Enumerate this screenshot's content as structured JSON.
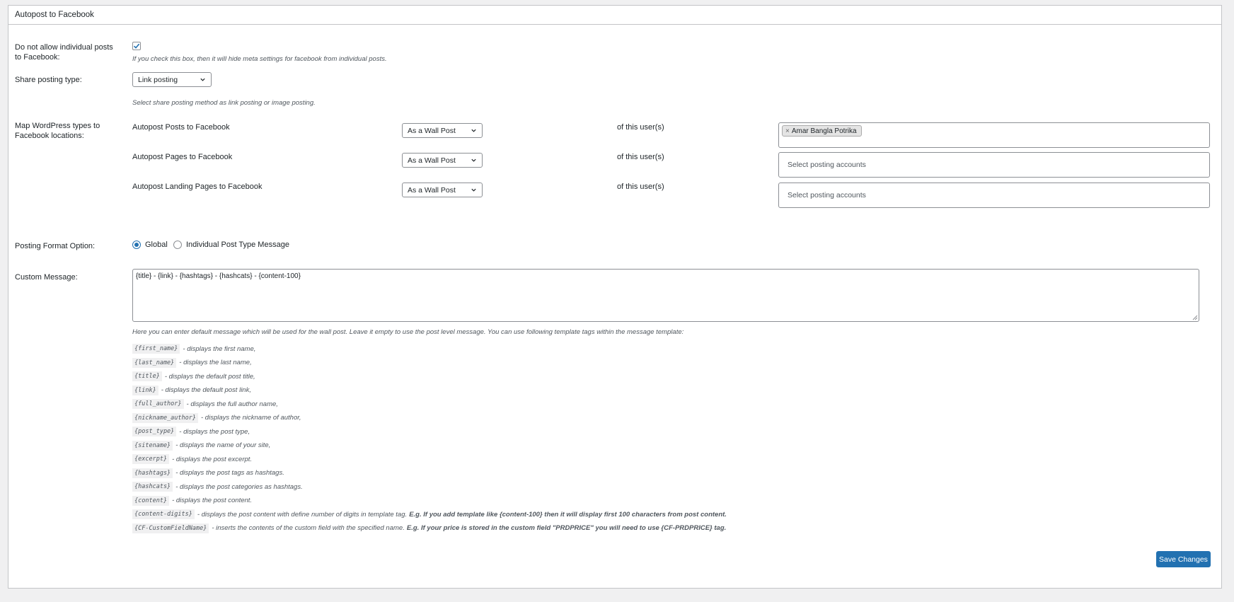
{
  "panel": {
    "title": "Autopost to Facebook"
  },
  "disable_individual": {
    "label": "Do not allow individual posts to Facebook:",
    "checked": true,
    "description": "If you check this box, then it will hide meta settings for facebook from individual posts."
  },
  "share_type": {
    "label": "Share posting type:",
    "selected": "Link posting",
    "description": "Select share posting method as link posting or image posting."
  },
  "mapping": {
    "label": "Map WordPress types to Facebook locations:",
    "of_user_label": "of this user(s)",
    "rows": [
      {
        "type": "Autopost Posts to Facebook",
        "location": "As a Wall Post",
        "accounts": [
          "Amar Bangla Potrika"
        ],
        "placeholder": ""
      },
      {
        "type": "Autopost Pages to Facebook",
        "location": "As a Wall Post",
        "accounts": [],
        "placeholder": "Select posting accounts"
      },
      {
        "type": "Autopost Landing Pages to Facebook",
        "location": "As a Wall Post",
        "accounts": [],
        "placeholder": "Select posting accounts"
      }
    ]
  },
  "posting_format": {
    "label": "Posting Format Option:",
    "options": [
      "Global",
      "Individual Post Type Message"
    ],
    "selected": "Global"
  },
  "custom_message": {
    "label": "Custom Message:",
    "value": "{title} - {link} - {hashtags} - {hashcats} - {content-100}",
    "description": "Here you can enter default message which will be used for the wall post. Leave it empty to use the post level message. You can use following template tags within the message template:"
  },
  "template_tags": [
    {
      "tag": "{first_name}",
      "desc": "- displays the first name,"
    },
    {
      "tag": "{last_name}",
      "desc": "- displays the last name,"
    },
    {
      "tag": "{title}",
      "desc": "- displays the default post title,"
    },
    {
      "tag": "{link}",
      "desc": "- displays the default post link,"
    },
    {
      "tag": "{full_author}",
      "desc": "- displays the full author name,"
    },
    {
      "tag": "{nickname_author}",
      "desc": "- displays the nickname of author,"
    },
    {
      "tag": "{post_type}",
      "desc": "- displays the post type,"
    },
    {
      "tag": "{sitename}",
      "desc": "- displays the name of your site,"
    },
    {
      "tag": "{excerpt}",
      "desc": "- displays the post excerpt."
    },
    {
      "tag": "{hashtags}",
      "desc": "- displays the post tags as hashtags."
    },
    {
      "tag": "{hashcats}",
      "desc": "- displays the post categories as hashtags."
    },
    {
      "tag": "{content}",
      "desc": "- displays the post content."
    },
    {
      "tag": "{content-digits}",
      "desc": "- displays the post content with define number of digits in template tag.",
      "extra": "E.g. If you add template like {content-100} then it will display first 100 characters from post content."
    },
    {
      "tag": "{CF-CustomFieldName}",
      "desc": "- inserts the contents of the custom field with the specified name.",
      "extra": "E.g. If your price is stored in the custom field \"PRDPRICE\" you will need to use {CF-PRDPRICE} tag."
    }
  ],
  "actions": {
    "save_label": "Save Changes"
  },
  "colors": {
    "accent": "#2271b1",
    "border": "#c3c4c7",
    "background": "#f0f0f1"
  }
}
